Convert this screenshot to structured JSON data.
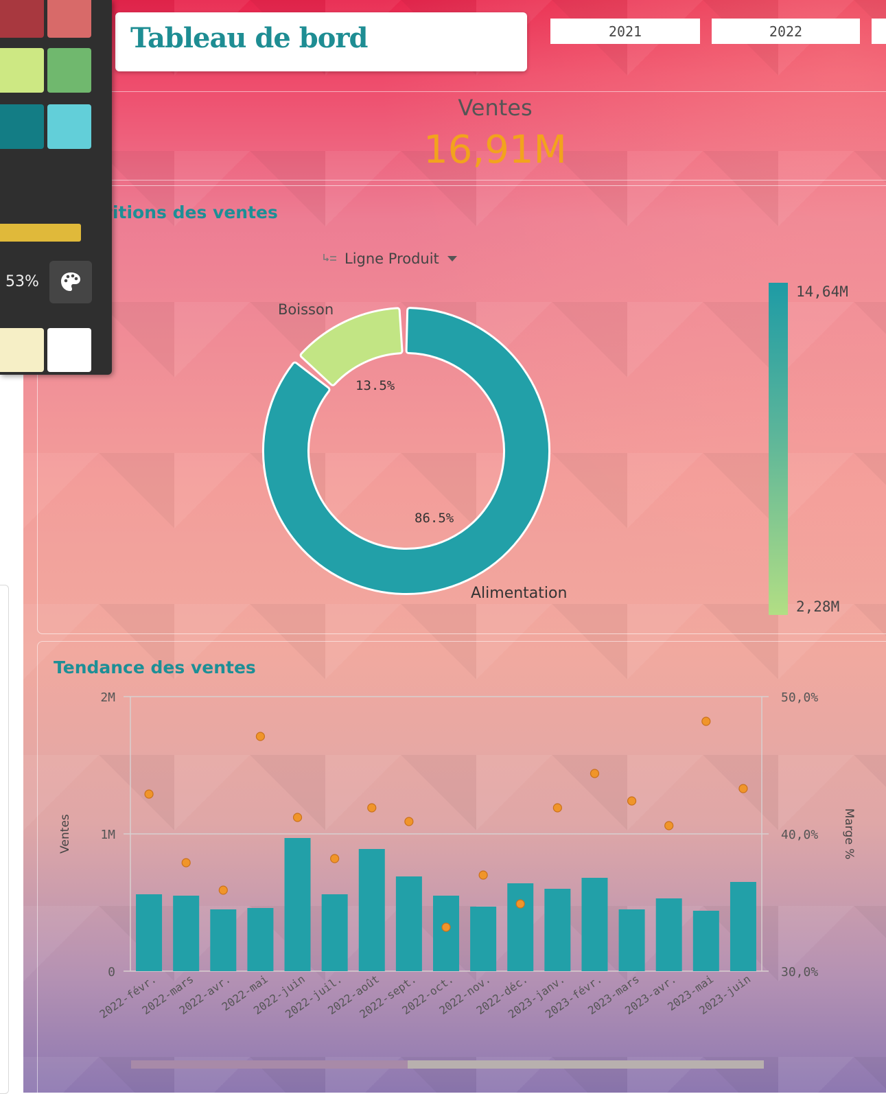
{
  "dashboard": {
    "title": "Tableau de bord",
    "years": [
      "2021",
      "2022"
    ]
  },
  "kpi": {
    "label": "Ventes",
    "value": "16,91M",
    "value_color": "#f2a31d"
  },
  "donut": {
    "title": "titions des ventes",
    "dimension_selector": "Ligne Produit",
    "slices": [
      {
        "name": "Boisson",
        "percent_label": "13.5%",
        "share": 0.135,
        "color": "#c2e584"
      },
      {
        "name": "Alimentation",
        "percent_label": "86.5%",
        "share": 0.865,
        "color": "#22a0a8"
      }
    ],
    "legend_max": "14,64M",
    "legend_min": "2,28M"
  },
  "trend": {
    "title": "Tendance des ventes"
  },
  "palette": {
    "swatches": [
      "#a8383f",
      "#d86a69",
      "#cde883",
      "#70b86e",
      "#137d85",
      "#62cfd9",
      "#f6efc6",
      "#ffffff"
    ],
    "alpha_color": "#e0b93a",
    "opacity_label": "53%",
    "icon": "palette-icon"
  },
  "chart_data": {
    "type": "bar",
    "categories": [
      "2022-févr.",
      "2022-mars",
      "2022-avr.",
      "2022-mai",
      "2022-juin",
      "2022-juil.",
      "2022-août",
      "2022-sept.",
      "2022-oct.",
      "2022-nov.",
      "2022-déc.",
      "2023-janv.",
      "2023-févr.",
      "2023-mars",
      "2023-avr.",
      "2023-mai",
      "2023-juin"
    ],
    "series": [
      {
        "name": "Ventes",
        "type": "bar",
        "axis": "left",
        "color": "#22a0a8",
        "values": [
          0.56,
          0.55,
          0.45,
          0.46,
          0.97,
          0.56,
          0.89,
          0.69,
          0.55,
          0.47,
          0.64,
          0.6,
          0.68,
          0.45,
          0.53,
          0.44,
          0.65
        ]
      },
      {
        "name": "Marge %",
        "type": "scatter",
        "axis": "right",
        "color": "#f0952a",
        "values": [
          42.9,
          37.9,
          35.9,
          47.1,
          41.2,
          38.2,
          41.9,
          40.9,
          33.2,
          37.0,
          34.9,
          41.9,
          44.4,
          42.4,
          40.6,
          48.2,
          43.3
        ]
      }
    ],
    "ylabel": "Ventes",
    "ylabel_right": "Marge %",
    "ylim": [
      0,
      2
    ],
    "ylim_right": [
      30,
      50
    ],
    "yticks": [
      "0",
      "1M",
      "2M"
    ],
    "yticks_right": [
      "30,0%",
      "40,0%",
      "50,0%"
    ],
    "grid": true
  }
}
